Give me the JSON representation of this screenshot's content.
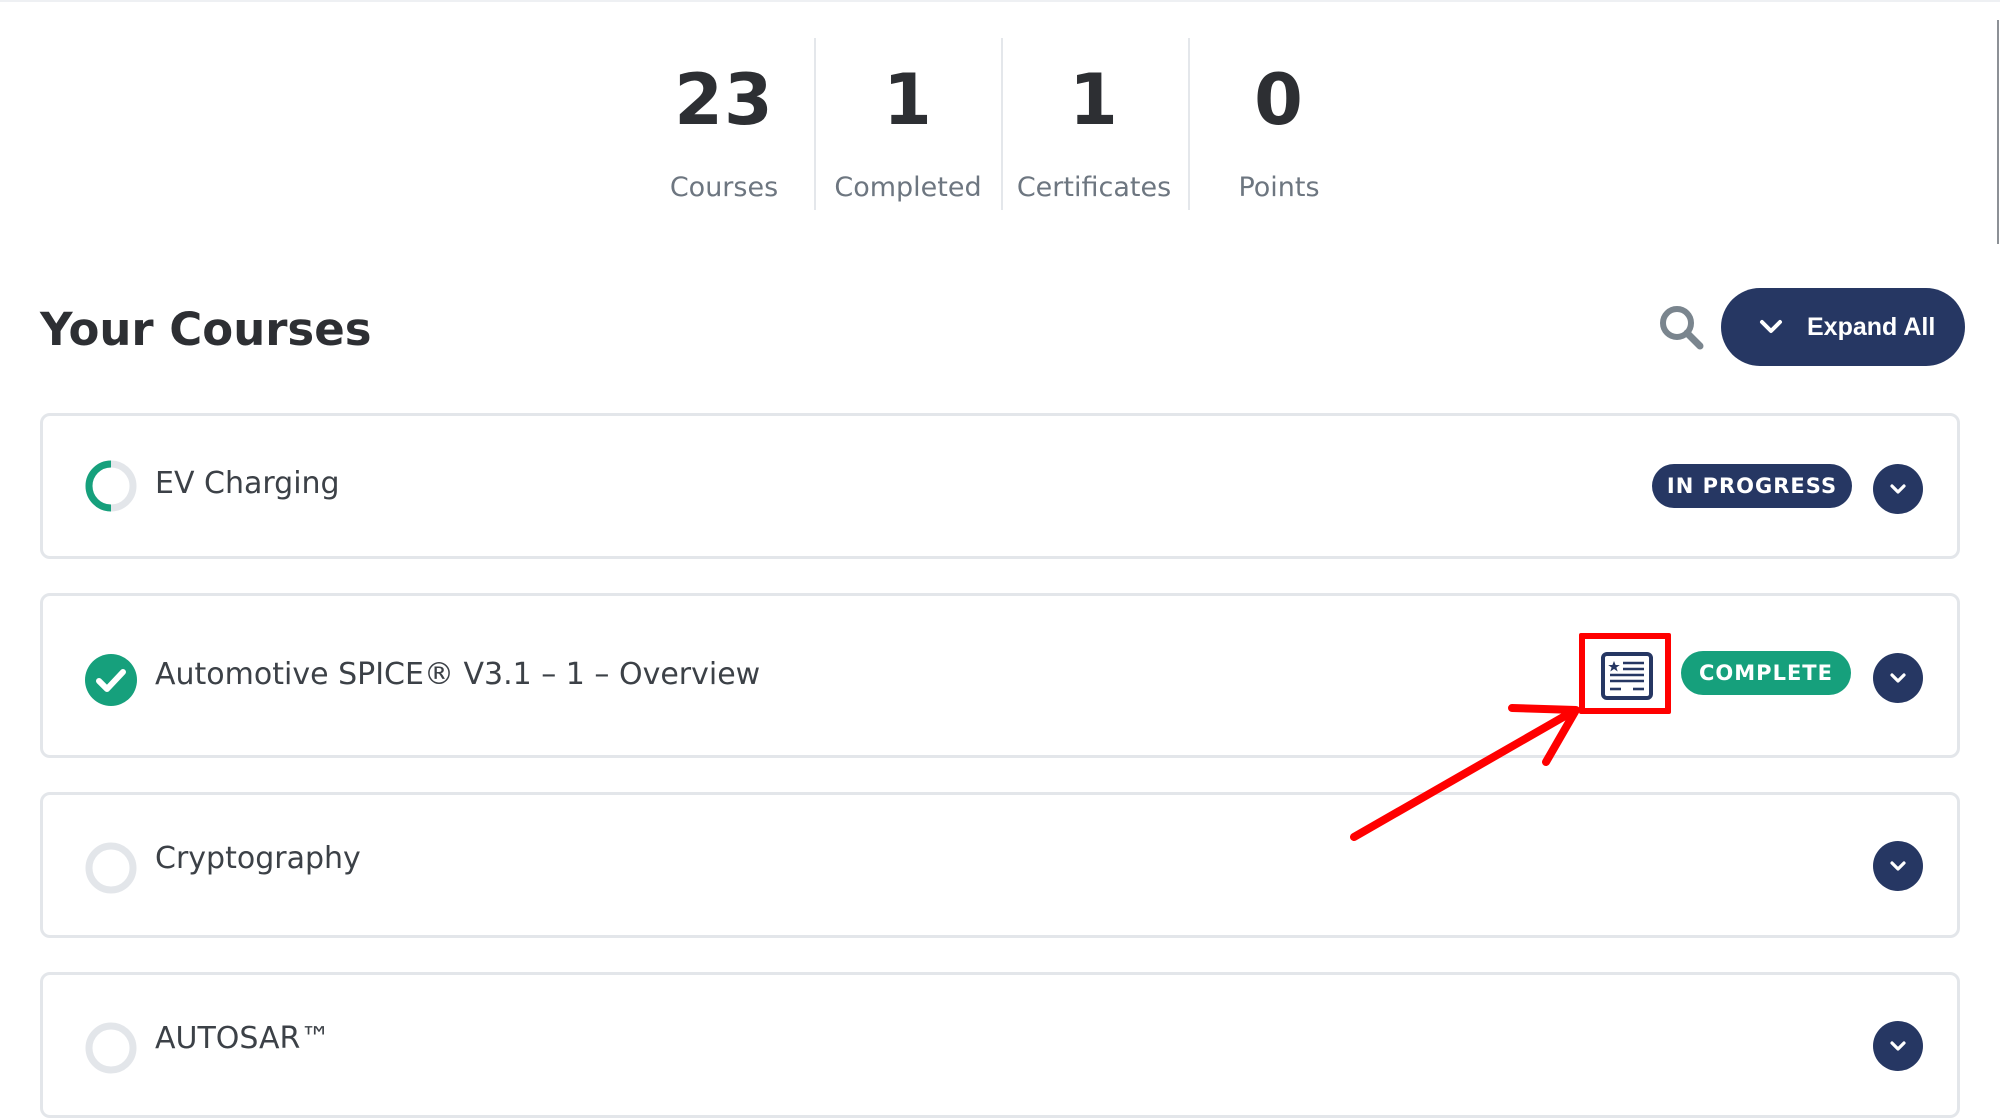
{
  "stats": [
    {
      "value": "23",
      "label": "Courses"
    },
    {
      "value": "1",
      "label": "Completed"
    },
    {
      "value": "1",
      "label": "Certificates"
    },
    {
      "value": "0",
      "label": "Points"
    }
  ],
  "section": {
    "title": "Your Courses",
    "search_icon": "search-icon",
    "expand_all_label": "Expand All"
  },
  "colors": {
    "navy": "#263763",
    "green": "#16a07c",
    "ring_gray": "#e3e6ea",
    "annotation_red": "#ff0000"
  },
  "courses": [
    {
      "title": "EV Charging",
      "status": "in-progress",
      "progress": 0.5,
      "badge": "IN PROGRESS",
      "has_certificate": false
    },
    {
      "title": "Automotive SPICE® V3.1 – 1 – Overview",
      "status": "complete",
      "progress": 1.0,
      "badge": "COMPLETE",
      "has_certificate": true
    },
    {
      "title": "Cryptography",
      "status": "not-started",
      "progress": 0,
      "badge": "",
      "has_certificate": false
    },
    {
      "title": "AUTOSAR™",
      "status": "not-started",
      "progress": 0,
      "badge": "",
      "has_certificate": false
    }
  ],
  "annotation": {
    "target": "certificate-icon",
    "type": "red-box-and-arrow"
  }
}
